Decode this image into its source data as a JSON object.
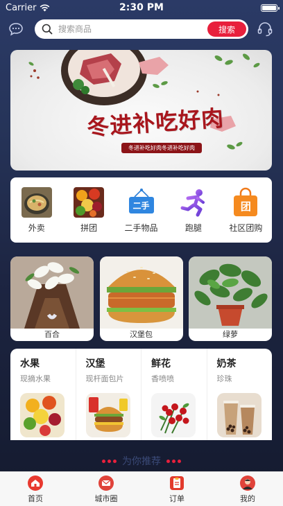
{
  "status_bar": {
    "carrier": "Carrier",
    "time": "2:30 PM",
    "battery": 1.0
  },
  "search": {
    "placeholder": "搜索商品",
    "button_label": "搜索"
  },
  "banner": {
    "title": "冬进补吃好肉",
    "subtitle": "冬进补吃好肉冬进补吃好肉"
  },
  "quick_menu": [
    {
      "label": "外卖",
      "icon": "noodle-bowl-photo"
    },
    {
      "label": "拼团",
      "icon": "fruit-photo"
    },
    {
      "label": "二手物品",
      "icon": "second-hand-sign-icon",
      "icon_text": "二手"
    },
    {
      "label": "跑腿",
      "icon": "running-person-icon"
    },
    {
      "label": "社区团购",
      "icon": "group-buy-bag-icon",
      "icon_text": "团"
    }
  ],
  "featured": [
    {
      "label": "百合",
      "image": "lily-bouquet"
    },
    {
      "label": "汉堡包",
      "image": "hamburger"
    },
    {
      "label": "绿萝",
      "image": "potted-plant"
    }
  ],
  "categories": [
    {
      "title": "水果",
      "subtitle": "现摘水果",
      "image": "fruit-bowl"
    },
    {
      "title": "汉堡",
      "subtitle": "现杆面包片",
      "image": "burger-meal"
    },
    {
      "title": "鲜花",
      "subtitle": "香喷喷",
      "image": "rose-bouquet"
    },
    {
      "title": "奶茶",
      "subtitle": "珍珠",
      "image": "bubble-tea"
    }
  ],
  "recommend_title": "为你推荐",
  "tabbar": [
    {
      "label": "首页",
      "icon": "home-icon"
    },
    {
      "label": "城市圈",
      "icon": "envelope-icon"
    },
    {
      "label": "订单",
      "icon": "clipboard-icon"
    },
    {
      "label": "我的",
      "icon": "user-avatar-icon"
    }
  ],
  "colors": {
    "accent": "#e8203c",
    "background": "#1d2542"
  }
}
